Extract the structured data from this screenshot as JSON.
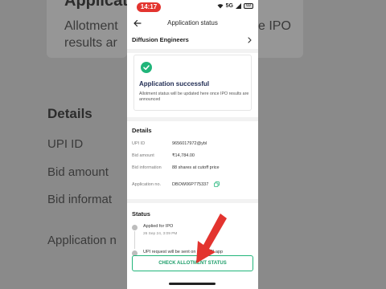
{
  "background": {
    "title": "Applicatio",
    "subtitle_line1": "Allotment",
    "subtitle_line2": "results ar",
    "right_subtitle": "e IPO",
    "details": "Details",
    "upi_label": "UPI ID",
    "bid_amount_label": "Bid amount",
    "bid_info_label": "Bid informat",
    "application_label": "Application n"
  },
  "status_bar": {
    "time": "14:17",
    "network": "5G",
    "battery": "69"
  },
  "app_bar": {
    "title": "Application status",
    "back_icon": "arrow-left-icon"
  },
  "company": {
    "name": "Diffusion Engineers",
    "chevron_icon": "chevron-right-icon"
  },
  "success_card": {
    "icon": "check-circle-icon",
    "title": "Application successful",
    "description": "Allotment status will be updated here once IPO results are announced"
  },
  "details": {
    "heading": "Details",
    "rows": [
      {
        "label": "UPI ID",
        "value": "9656017972@ybl"
      },
      {
        "label": "Bid amount",
        "value": "₹14,784.00"
      },
      {
        "label": "Bid information",
        "value": "88 shares at cutoff price"
      },
      {
        "label": "Application no.",
        "value": "DBOW06P775337"
      }
    ]
  },
  "status": {
    "heading": "Status",
    "steps": [
      {
        "title": "Applied for IPO",
        "subtitle": "26 Sep 24, 3:09 PM"
      },
      {
        "title": "UPI request will be sent on your UPI app",
        "subtitle": ""
      }
    ]
  },
  "cta": {
    "label": "CHECK ALLOTMENT STATUS"
  },
  "colors": {
    "accent_green": "#21b57a",
    "arrow_red": "#e3342f",
    "title_navy": "#1f2b52"
  }
}
